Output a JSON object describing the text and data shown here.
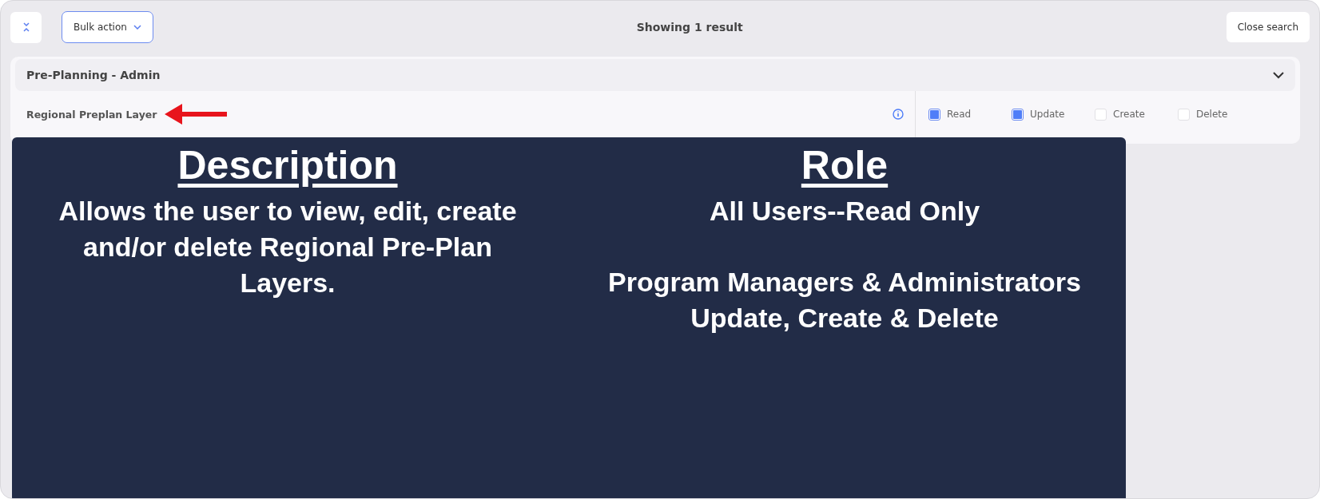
{
  "toolbar": {
    "bulk_action": "Bulk action",
    "status": "Showing 1 result",
    "close_button": "Close search"
  },
  "section": {
    "title": "Pre-Planning - Admin",
    "expanded": true,
    "rows": [
      {
        "label": "Regional Preplan Layer",
        "permissions": [
          {
            "label": "Read",
            "checked": true
          },
          {
            "label": "Update",
            "checked": true
          },
          {
            "label": "Create",
            "checked": false
          },
          {
            "label": "Delete",
            "checked": false
          }
        ]
      }
    ]
  },
  "overlay": {
    "columns": [
      {
        "heading": "Description",
        "paragraphs": [
          "Allows the user to view, edit, create and/or delete Regional Pre-Plan Layers."
        ]
      },
      {
        "heading": "Role",
        "paragraphs": [
          "All Users--Read Only",
          "Program Managers & Administrators Update, Create & Delete"
        ]
      }
    ]
  }
}
